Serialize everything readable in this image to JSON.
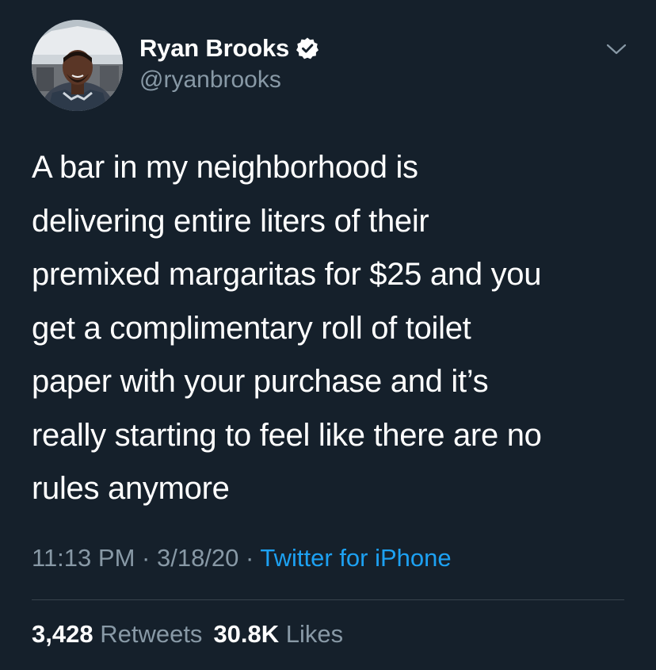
{
  "author": {
    "display_name": "Ryan Brooks",
    "handle": "@ryanbrooks",
    "verified": true,
    "avatar_icon": "profile-photo"
  },
  "tweet": {
    "text_lines": [
      "A bar in my neighborhood is",
      "delivering entire liters of their",
      "premixed margaritas for $25 and you",
      "get a complimentary roll of toilet",
      "paper with your purchase and it’s",
      "really starting to feel like there are no",
      "rules anymore"
    ],
    "time": "11:13 PM",
    "date": "3/18/20",
    "separator": "·",
    "source": "Twitter for iPhone"
  },
  "stats": {
    "retweets_count": "3,428",
    "retweets_label": "Retweets",
    "likes_count": "30.8K",
    "likes_label": "Likes"
  },
  "icons": {
    "verified": "verified-badge-icon",
    "menu": "chevron-down-icon"
  },
  "colors": {
    "background": "#15202b",
    "primary_text": "#ffffff",
    "secondary_text": "#8899a6",
    "link": "#1da1f2",
    "divider": "#38444d"
  }
}
